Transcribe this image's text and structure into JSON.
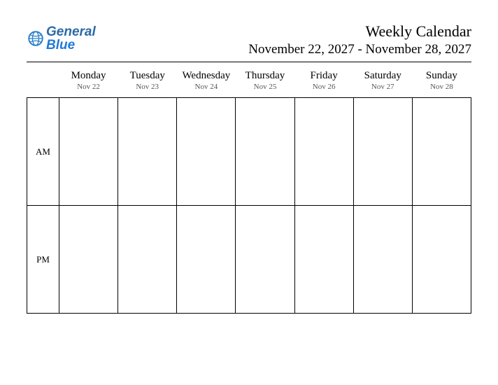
{
  "logo": {
    "general": "General",
    "blue": "Blue"
  },
  "header": {
    "title": "Weekly Calendar",
    "date_range": "November 22, 2027 - November 28, 2027"
  },
  "days": [
    {
      "name": "Monday",
      "date": "Nov 22"
    },
    {
      "name": "Tuesday",
      "date": "Nov 23"
    },
    {
      "name": "Wednesday",
      "date": "Nov 24"
    },
    {
      "name": "Thursday",
      "date": "Nov 25"
    },
    {
      "name": "Friday",
      "date": "Nov 26"
    },
    {
      "name": "Saturday",
      "date": "Nov 27"
    },
    {
      "name": "Sunday",
      "date": "Nov 28"
    }
  ],
  "periods": [
    {
      "label": "AM"
    },
    {
      "label": "PM"
    }
  ]
}
